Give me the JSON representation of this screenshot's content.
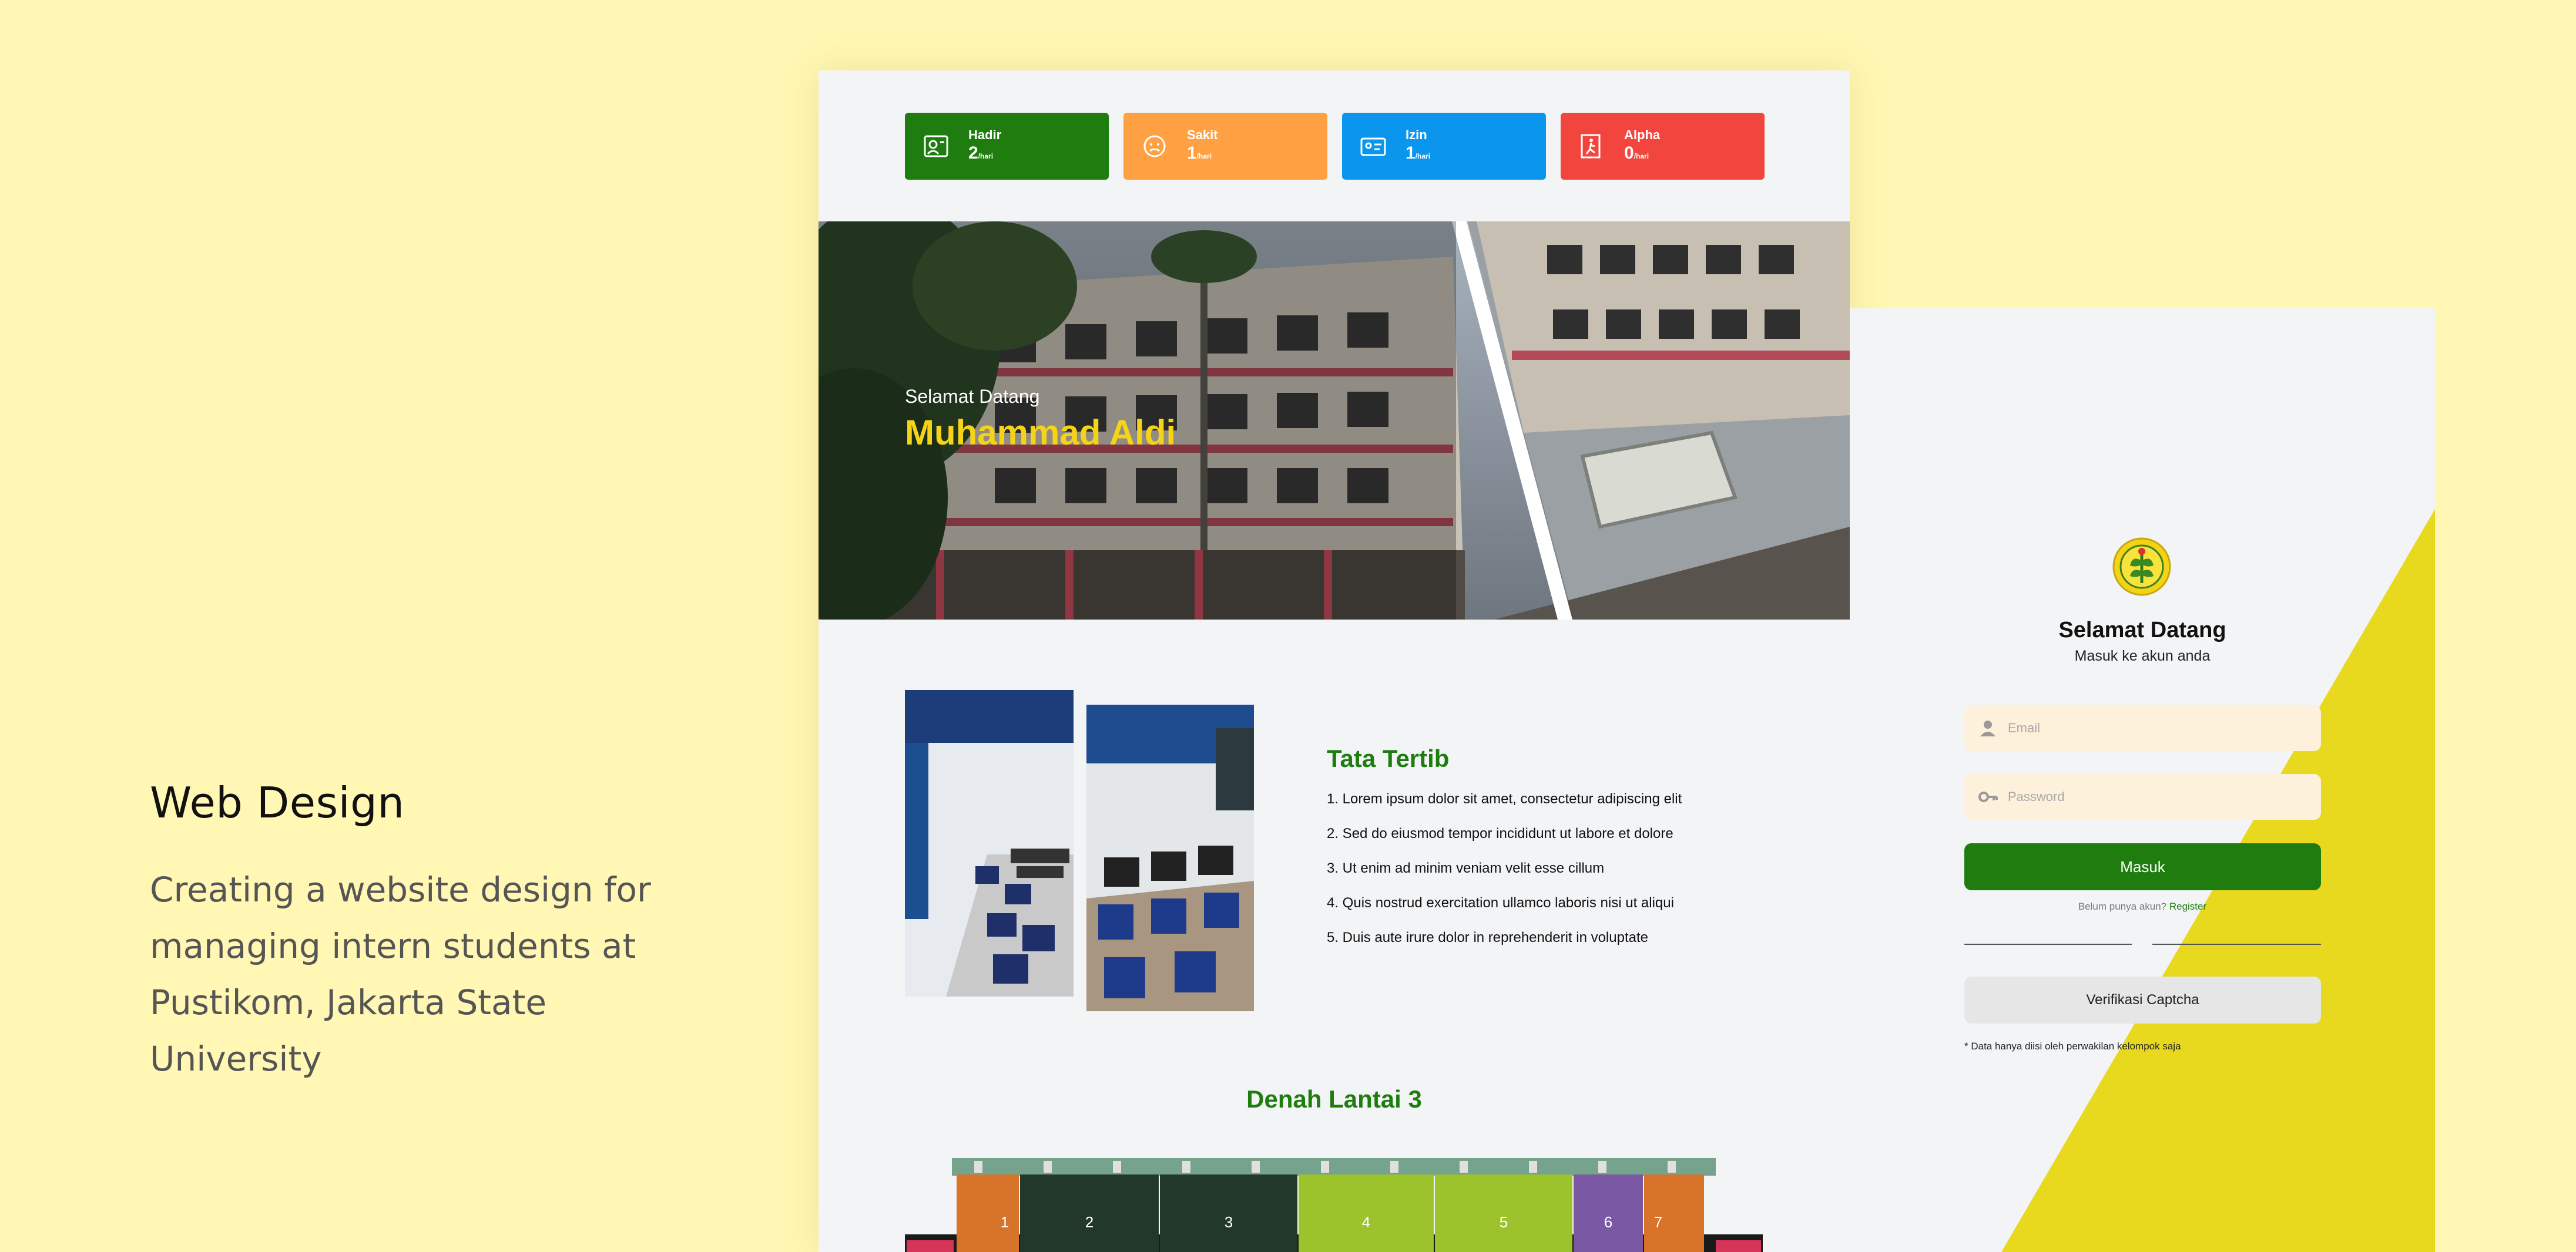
{
  "caption": {
    "title": "Web Design",
    "description": "Creating a website design for managing intern students at Pustikom, Jakarta State University"
  },
  "dashboard": {
    "stats": [
      {
        "label": "Hadir",
        "value": "2",
        "unit": "/hari",
        "color": "#1e7d0e",
        "icon": "user-badge-icon"
      },
      {
        "label": "Sakit",
        "value": "1",
        "unit": "/hari",
        "color": "#ffa143",
        "icon": "sick-face-icon"
      },
      {
        "label": "Izin",
        "value": "1",
        "unit": "/hari",
        "color": "#0b96ee",
        "icon": "id-card-icon"
      },
      {
        "label": "Alpha",
        "value": "0",
        "unit": "/hari",
        "color": "#f2453d",
        "icon": "exit-run-icon"
      }
    ],
    "hero": {
      "greeting": "Selamat Datang",
      "name": "Muhammad Aldi"
    },
    "rules": {
      "title": "Tata Tertib",
      "items": [
        "1. Lorem ipsum dolor sit amet, consectetur adipiscing elit",
        "2. Sed do eiusmod tempor incididunt ut labore et dolore",
        "3. Ut enim ad minim veniam velit esse cillum",
        "4. Quis nostrud exercitation ullamco laboris nisi ut aliqui",
        "5. Duis aute irure dolor in reprehenderit in voluptate"
      ]
    },
    "floor_plan": {
      "title": "Denah Lantai 3",
      "rooms": [
        "1",
        "2",
        "3",
        "4",
        "5",
        "6",
        "7"
      ]
    }
  },
  "login": {
    "title": "Selamat Datang",
    "subtitle": "Masuk ke akun anda",
    "email_placeholder": "Email",
    "password_placeholder": "Password",
    "submit_label": "Masuk",
    "register_prompt": "Belum punya akun?",
    "register_link": "Register",
    "captcha_label": "Verifikasi Captcha",
    "note": "* Data hanya diisi oleh perwakilan kelompok saja",
    "accent_color": "#e8d81e"
  }
}
